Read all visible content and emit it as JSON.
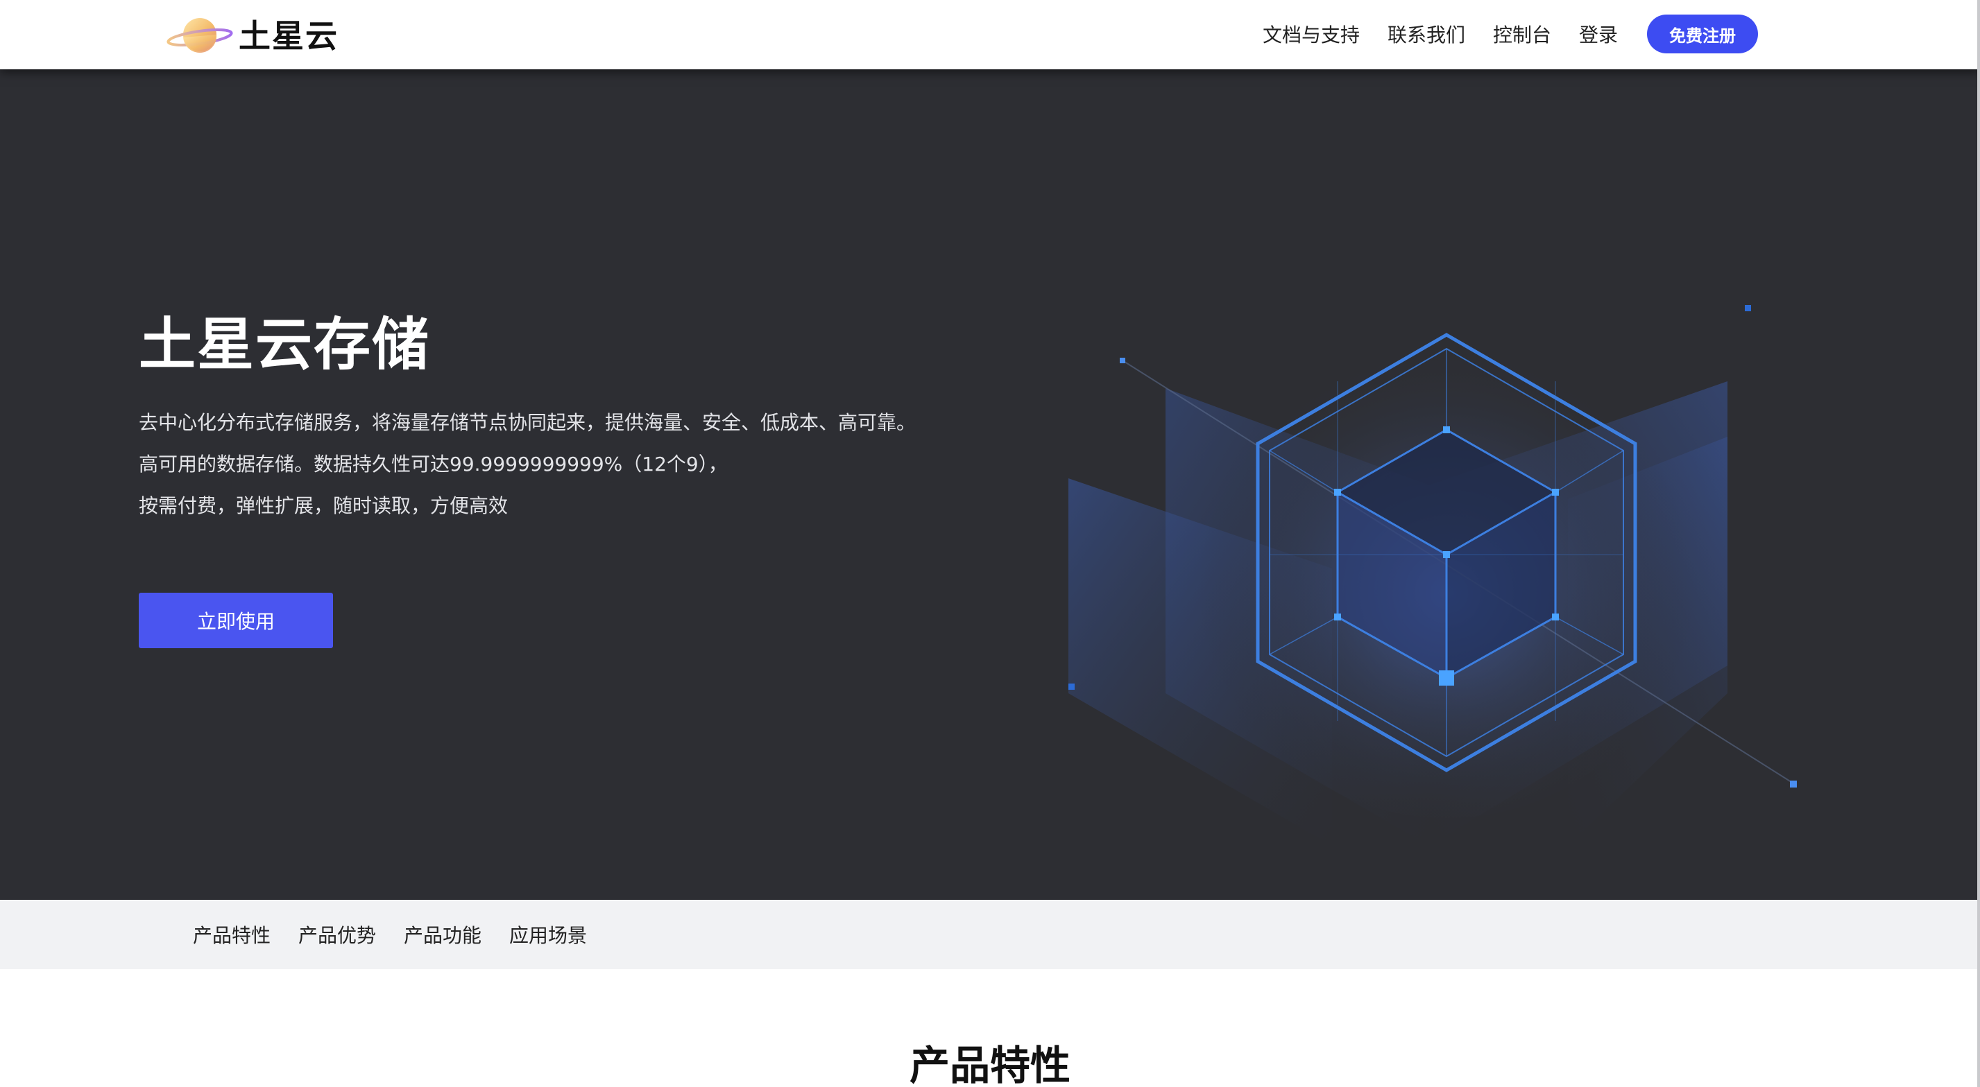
{
  "header": {
    "logo_text": "土星云",
    "nav": [
      "文档与支持",
      "联系我们",
      "控制台",
      "登录"
    ],
    "signup_label": "免费注册"
  },
  "hero": {
    "title": "土星云存储",
    "desc_lines": [
      "去中心化分布式存储服务，将海量存储节点协同起来，提供海量、安全、低成本、高可靠。",
      "高可用的数据存储。数据持久性可达99.9999999999%（12个9），",
      "按需付费，弹性扩展，随时读取，方便高效"
    ],
    "cta_label": "立即使用"
  },
  "subnav": [
    "产品特性",
    "产品优势",
    "产品功能",
    "应用场景"
  ],
  "section": {
    "title": "产品特性"
  },
  "colors": {
    "accent": "#4a55f0",
    "signup": "#3d4cf2",
    "hero_bg": "#2d2e33",
    "subnav_bg": "#f1f2f4",
    "hex_line": "#3d7fe0"
  },
  "icons": {
    "logo": "saturn-planet-icon",
    "hero_illustration": "hexagon-cube-network-icon"
  }
}
